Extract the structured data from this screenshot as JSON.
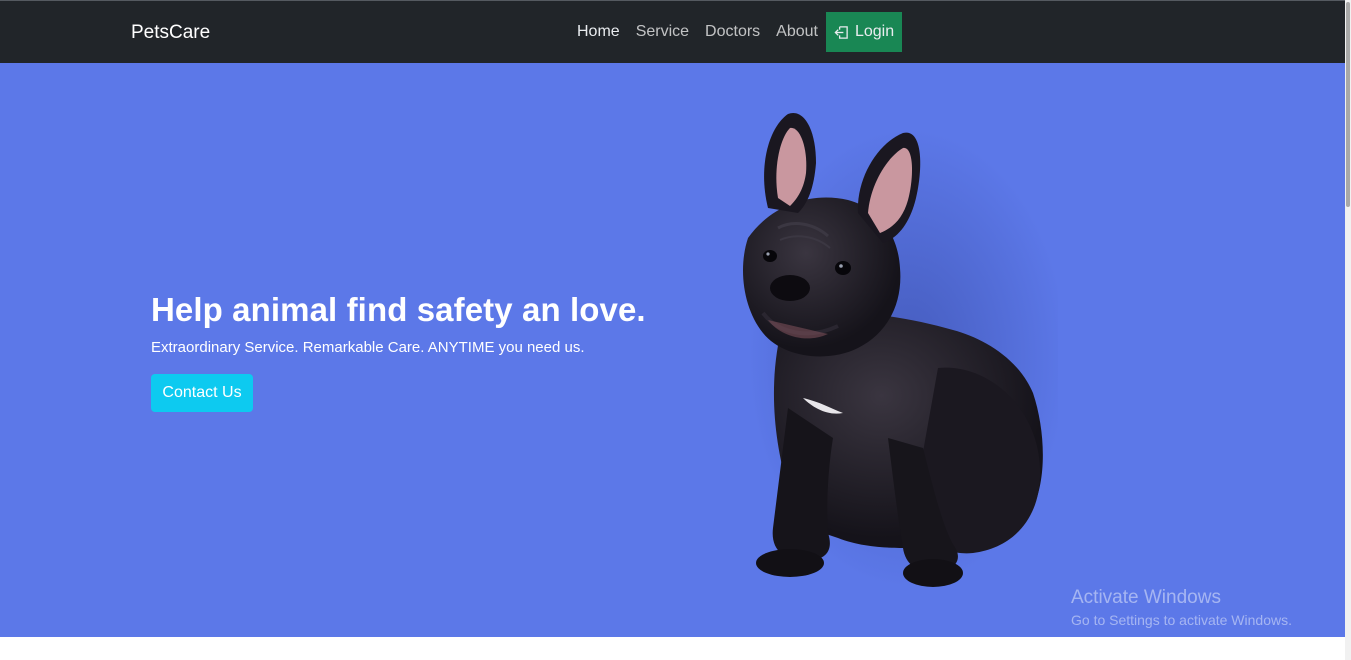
{
  "navbar": {
    "brand": "PetsCare",
    "links": [
      "Home",
      "Service",
      "Doctors",
      "About"
    ],
    "login_label": "Login",
    "login_icon": "box-arrow-in-left-icon",
    "background": "#212529",
    "login_color": "#198754"
  },
  "hero": {
    "title": "Help animal find safety an love.",
    "subtitle": "Extraordinary Service. Remarkable Care. ANYTIME you need us.",
    "cta_label": "Contact Us",
    "background": "#5c78e8",
    "cta_color": "#0dcaf0",
    "image": "french-bulldog-photo"
  },
  "watermark": {
    "title": "Activate Windows",
    "subtitle": "Go to Settings to activate Windows."
  }
}
